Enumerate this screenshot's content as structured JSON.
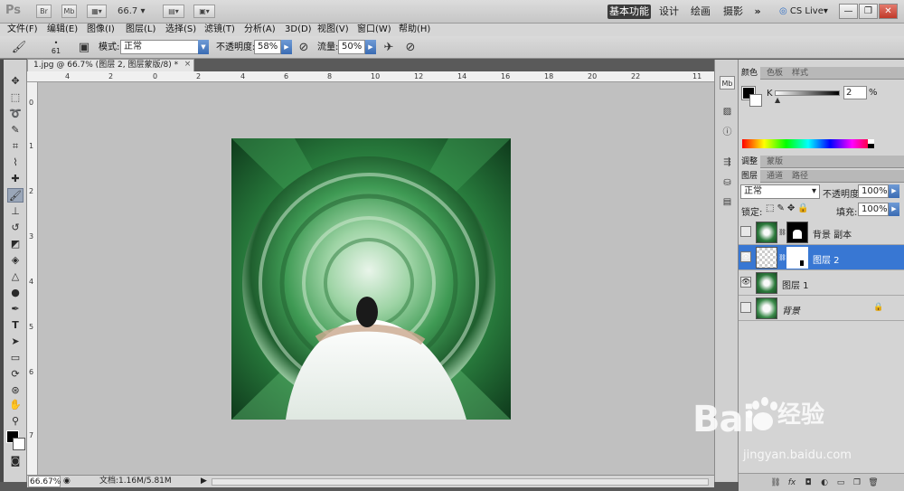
{
  "titlebar": {
    "app_logo": "Ps",
    "btn_br": "Br",
    "btn_mb": "Mb",
    "zoom": "66.7",
    "workspaces": [
      "基本功能",
      "设计",
      "绘画",
      "摄影"
    ],
    "more": "»",
    "cslive": "CS Live▾"
  },
  "menu": [
    "文件(F)",
    "编辑(E)",
    "图像(I)",
    "图层(L)",
    "选择(S)",
    "滤镜(T)",
    "分析(A)",
    "3D(D)",
    "视图(V)",
    "窗口(W)",
    "帮助(H)"
  ],
  "options": {
    "brush_size": "61",
    "mode_label": "模式:",
    "mode_value": "正常",
    "opacity_label": "不透明度:",
    "opacity_value": "58%",
    "flow_label": "流量:",
    "flow_value": "50%"
  },
  "document": {
    "tab_title": "1.jpg @ 66.7% (图层 2, 图层蒙版/8) *",
    "close": "×",
    "ruler_top": [
      "4",
      "2",
      "0",
      "2",
      "4",
      "6",
      "8",
      "10",
      "12",
      "14",
      "16",
      "18",
      "20",
      "22",
      "11"
    ],
    "ruler_left": [
      "0",
      "1",
      "2",
      "3",
      "4",
      "5",
      "6",
      "7"
    ]
  },
  "status": {
    "zoom": "66.67%",
    "doc_size": "文档:1.16M/5.81M"
  },
  "color_panel": {
    "tabs": [
      "颜色",
      "色板",
      "样式"
    ],
    "channel_label": "K",
    "channel_value": "2",
    "channel_unit": "%"
  },
  "adjust_panel": {
    "tabs": [
      "调整",
      "蒙版"
    ]
  },
  "layers_panel": {
    "tabs": [
      "图层",
      "通道",
      "路径"
    ],
    "blend_mode": "正常",
    "opacity_label": "不透明度:",
    "opacity_value": "100%",
    "lock_label": "锁定:",
    "fill_label": "填充:",
    "fill_value": "100%",
    "layers": [
      {
        "name": "背景 副本",
        "visible": false,
        "selected": false,
        "has_mask": true
      },
      {
        "name": "图层 2",
        "visible": true,
        "selected": true,
        "has_mask": true
      },
      {
        "name": "图层 1",
        "visible": true,
        "selected": false,
        "has_mask": false
      },
      {
        "name": "背景",
        "visible": false,
        "selected": false,
        "has_mask": false,
        "locked": true
      }
    ]
  },
  "watermark": {
    "logo": "Bai",
    "brand_cn": "经验",
    "url": "jingyan.baidu.com"
  }
}
